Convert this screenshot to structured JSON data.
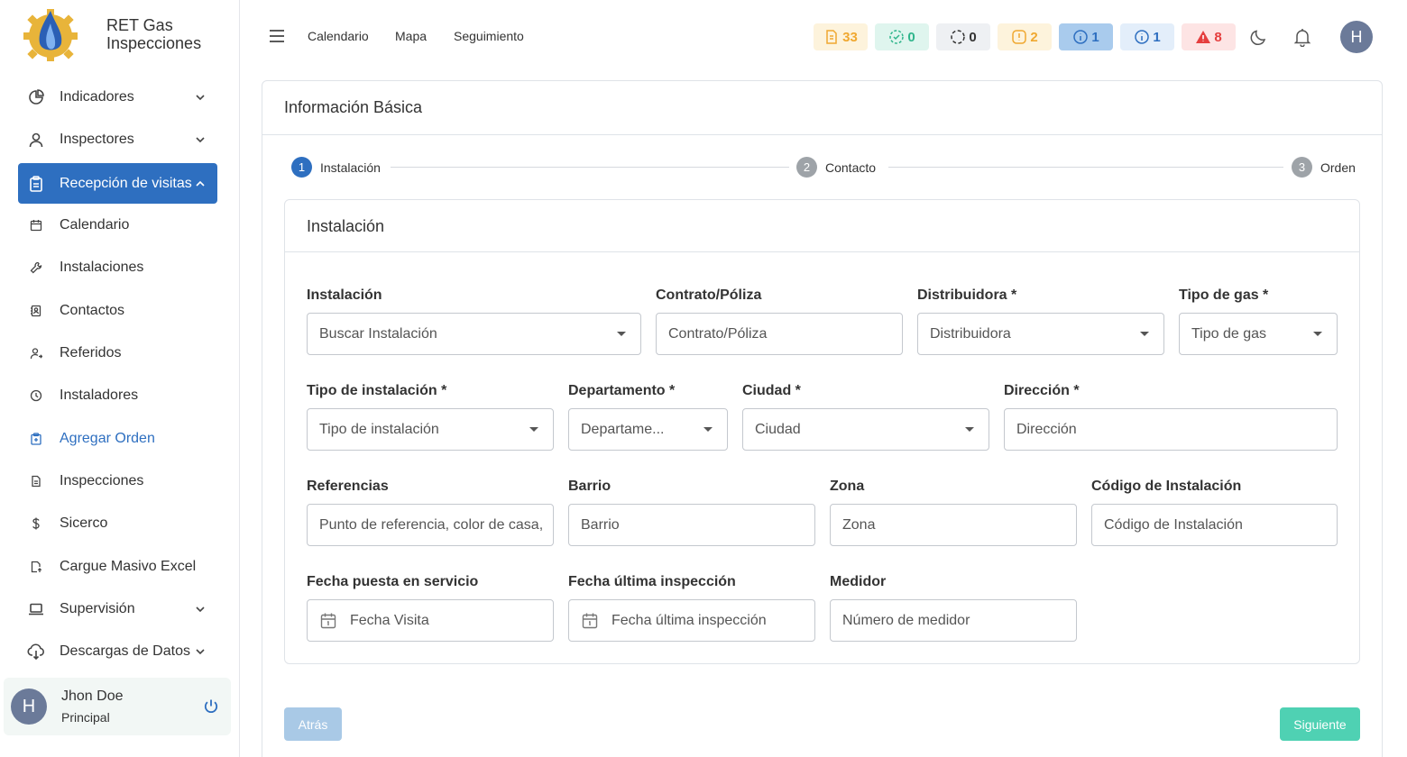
{
  "app": {
    "name_line1": "RET Gas",
    "name_line2": "Inspecciones"
  },
  "sidebar": {
    "items": [
      {
        "label": "Indicadores",
        "icon": "pie-chart-icon",
        "expandable": true
      },
      {
        "label": "Inspectores",
        "icon": "user-icon",
        "expandable": true
      },
      {
        "label": "Recepción de visitas",
        "icon": "clipboard-icon",
        "expandable": true,
        "expanded": true,
        "active": true
      },
      {
        "label": "Calendario",
        "icon": "calendar-icon"
      },
      {
        "label": "Instalaciones",
        "icon": "wrench-icon"
      },
      {
        "label": "Contactos",
        "icon": "contacts-icon"
      },
      {
        "label": "Referidos",
        "icon": "user-referral-icon"
      },
      {
        "label": "Instaladores",
        "icon": "clock-icon"
      },
      {
        "label": "Agregar Orden",
        "icon": "clipboard-add-icon",
        "selected": true
      },
      {
        "label": "Inspecciones",
        "icon": "document-icon"
      },
      {
        "label": "Sicerco",
        "icon": "dollar-icon"
      },
      {
        "label": "Cargue Masivo Excel",
        "icon": "file-upload-icon"
      },
      {
        "label": "Supervisión",
        "icon": "laptop-icon",
        "expandable": true
      },
      {
        "label": "Descargas de Datos",
        "icon": "cloud-download-icon",
        "expandable": true
      }
    ],
    "user": {
      "initial": "H",
      "name": "Jhon Doe",
      "role": "Principal"
    }
  },
  "topbar": {
    "links": [
      "Calendario",
      "Mapa",
      "Seguimiento"
    ],
    "badges": [
      {
        "count": "33",
        "icon": "document-badge-icon",
        "color": "#f0a830",
        "bg": "#fdf3dc"
      },
      {
        "count": "0",
        "icon": "check-dashed-icon",
        "color": "#2fb58b",
        "bg": "#dff5ee"
      },
      {
        "count": "0",
        "icon": "loading-circle-icon",
        "color": "#333333",
        "bg": "#eef0f3"
      },
      {
        "count": "2",
        "icon": "warning-circle-icon",
        "color": "#f0a830",
        "bg": "#fdf3dc"
      },
      {
        "count": "1",
        "icon": "info-circle-icon",
        "color": "#2e6fc0",
        "bg": "#a9cbed"
      },
      {
        "count": "1",
        "icon": "info-circle-icon",
        "color": "#2e6fc0",
        "bg": "#e3eefa"
      },
      {
        "count": "8",
        "icon": "alert-triangle-icon",
        "color": "#e53e3e",
        "bg": "#fde4e4"
      }
    ],
    "avatar_initial": "H"
  },
  "main": {
    "title": "Información Básica",
    "steps": [
      {
        "num": "1",
        "label": "Instalación",
        "active": true
      },
      {
        "num": "2",
        "label": "Contacto"
      },
      {
        "num": "3",
        "label": "Orden"
      }
    ],
    "section_title": "Instalación",
    "fields": {
      "instalacion": {
        "label": "Instalación",
        "placeholder": "Buscar Instalación"
      },
      "contrato": {
        "label": "Contrato/Póliza",
        "placeholder": "Contrato/Póliza"
      },
      "distribuidora": {
        "label": "Distribuidora *",
        "placeholder": "Distribuidora"
      },
      "tipo_gas": {
        "label": "Tipo de gas *",
        "placeholder": "Tipo de gas"
      },
      "tipo_instalacion": {
        "label": "Tipo de instalación *",
        "placeholder": "Tipo de instalación"
      },
      "departamento": {
        "label": "Departamento *",
        "placeholder": "Departame..."
      },
      "ciudad": {
        "label": "Ciudad *",
        "placeholder": "Ciudad"
      },
      "direccion": {
        "label": "Dirección *",
        "placeholder": "Dirección"
      },
      "referencias": {
        "label": "Referencias",
        "placeholder": "Punto de referencia, color de casa,"
      },
      "barrio": {
        "label": "Barrio",
        "placeholder": "Barrio"
      },
      "zona": {
        "label": "Zona",
        "placeholder": "Zona"
      },
      "codigo": {
        "label": "Código de Instalación",
        "placeholder": "Código de Instalación"
      },
      "fecha_servicio": {
        "label": "Fecha puesta en servicio",
        "placeholder": "Fecha Visita"
      },
      "fecha_inspeccion": {
        "label": "Fecha última inspección",
        "placeholder": "Fecha última inspección"
      },
      "medidor": {
        "label": "Medidor",
        "placeholder": "Número de medidor"
      }
    },
    "buttons": {
      "back": "Atrás",
      "next": "Siguiente"
    }
  }
}
